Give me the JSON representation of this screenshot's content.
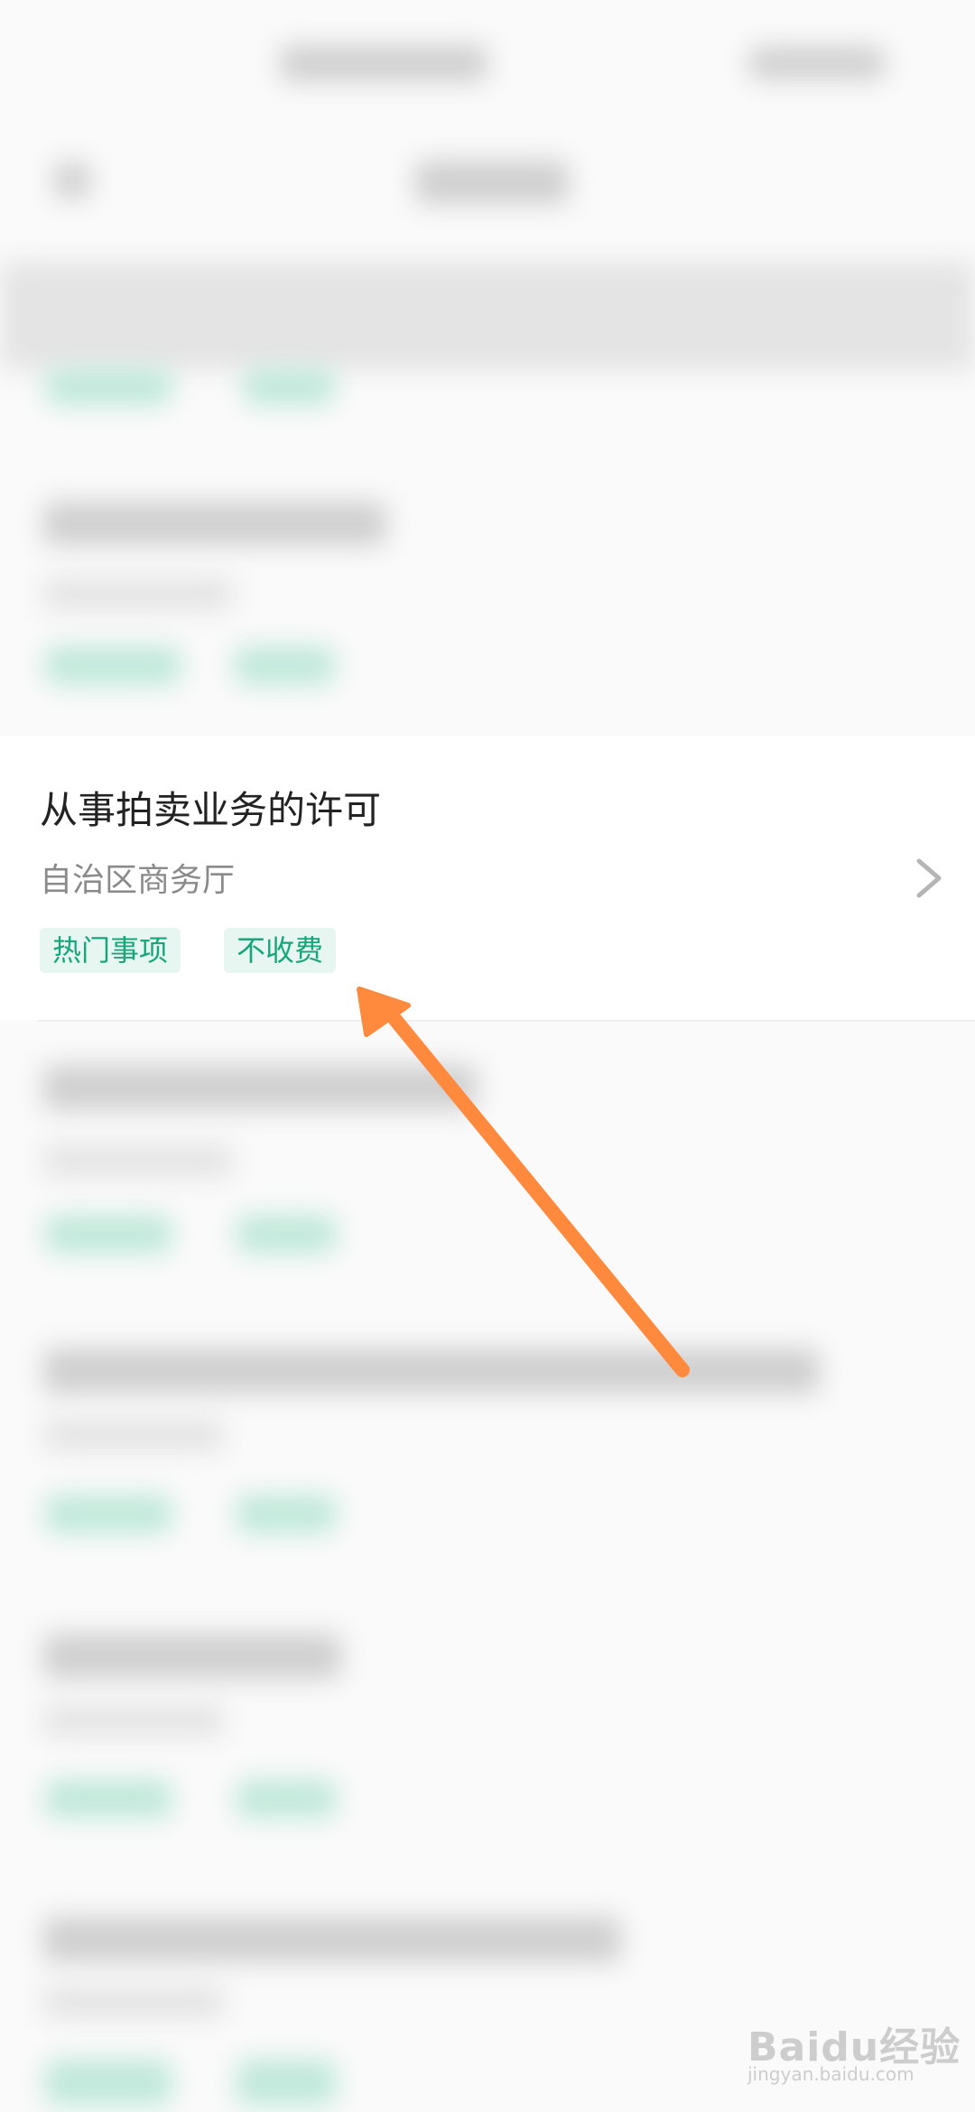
{
  "list_item": {
    "title": "从事拍卖业务的许可",
    "department": "自治区商务厅",
    "tags": [
      "热门事项",
      "不收费"
    ]
  },
  "watermark": {
    "text": "Baidu经验",
    "sub": "jingyan.baidu.com"
  },
  "colors": {
    "tag_text": "#17a67a",
    "tag_bg": "#e7f6f0",
    "arrow": "#ff8a3d"
  },
  "icons": {
    "item_chevron": "chevron-right-icon",
    "annotation": "arrow-annotation"
  }
}
